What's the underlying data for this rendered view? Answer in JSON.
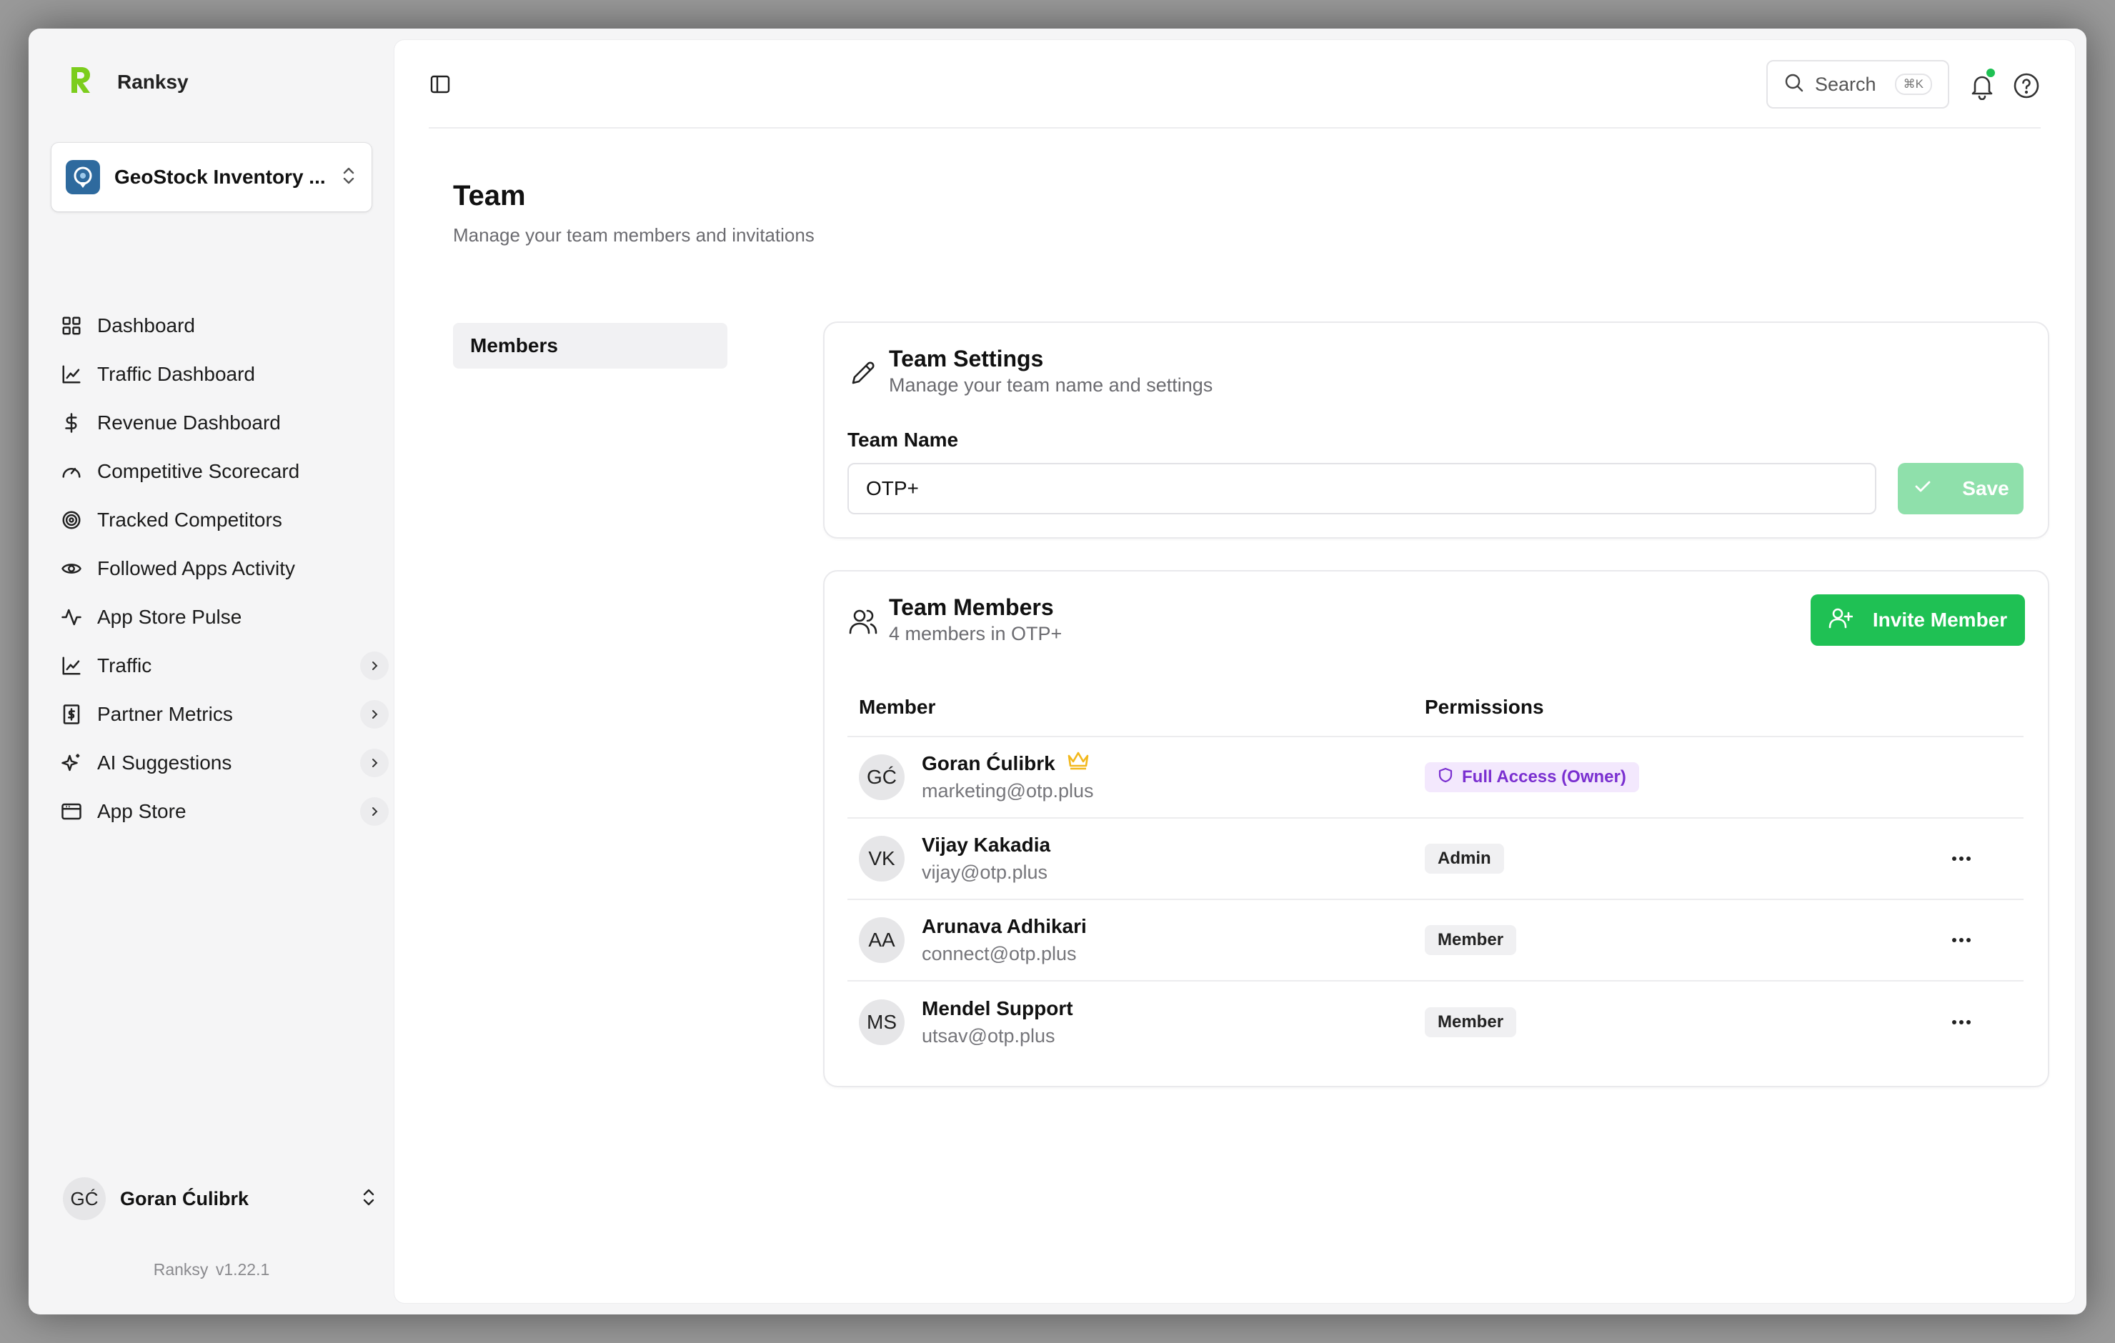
{
  "app": {
    "name": "Ranksy",
    "version": "Ranksy  v1.22.1"
  },
  "colors": {
    "accent": "#1fc154",
    "accent_light": "#8fe0ab",
    "owner_badge_text": "#7a2fd0",
    "owner_badge_bg": "#f3e8fd",
    "brand_logo": "#7ccd1d"
  },
  "team_switcher": {
    "label": "GeoStock Inventory ...",
    "icon": "geostock-logo-icon"
  },
  "sidebar": {
    "items": [
      {
        "label": "Dashboard",
        "icon": "grid-icon",
        "has_chevron": false
      },
      {
        "label": "Traffic Dashboard",
        "icon": "line-chart-icon",
        "has_chevron": false
      },
      {
        "label": "Revenue Dashboard",
        "icon": "dollar-icon",
        "has_chevron": false
      },
      {
        "label": "Competitive Scorecard",
        "icon": "gauge-icon",
        "has_chevron": false
      },
      {
        "label": "Tracked Competitors",
        "icon": "target-icon",
        "has_chevron": false
      },
      {
        "label": "Followed Apps Activity",
        "icon": "eye-icon",
        "has_chevron": false
      },
      {
        "label": "App Store Pulse",
        "icon": "pulse-icon",
        "has_chevron": false
      },
      {
        "label": "Traffic",
        "icon": "line-chart-icon",
        "has_chevron": true
      },
      {
        "label": "Partner Metrics",
        "icon": "receipt-dollar-icon",
        "has_chevron": true
      },
      {
        "label": "AI Suggestions",
        "icon": "sparkles-icon",
        "has_chevron": true
      },
      {
        "label": "App Store",
        "icon": "browser-window-icon",
        "has_chevron": true
      }
    ],
    "user": {
      "initials": "GĆ",
      "name": "Goran Ćulibrk"
    }
  },
  "topbar": {
    "search_label": "Search",
    "search_shortcut": "⌘K"
  },
  "page": {
    "title": "Team",
    "subtitle": "Manage your team members and invitations",
    "subnav": [
      "Members"
    ]
  },
  "team_settings": {
    "title": "Team Settings",
    "subtitle": "Manage your team name and settings",
    "field_label": "Team Name",
    "team_name": "OTP+",
    "save_label": "Save"
  },
  "team_members": {
    "title": "Team Members",
    "subtitle": "4 members in OTP+",
    "invite_label": "Invite Member",
    "columns": [
      "Member",
      "Permissions"
    ],
    "rows": [
      {
        "initials": "GĆ",
        "name": "Goran Ćulibrk",
        "email": "marketing@otp.plus",
        "permission": "Full Access (Owner)",
        "owner": true
      },
      {
        "initials": "VK",
        "name": "Vijay Kakadia",
        "email": "vijay@otp.plus",
        "permission": "Admin",
        "owner": false
      },
      {
        "initials": "AA",
        "name": "Arunava Adhikari",
        "email": "connect@otp.plus",
        "permission": "Member",
        "owner": false
      },
      {
        "initials": "MS",
        "name": "Mendel Support",
        "email": "utsav@otp.plus",
        "permission": "Member",
        "owner": false
      }
    ]
  }
}
